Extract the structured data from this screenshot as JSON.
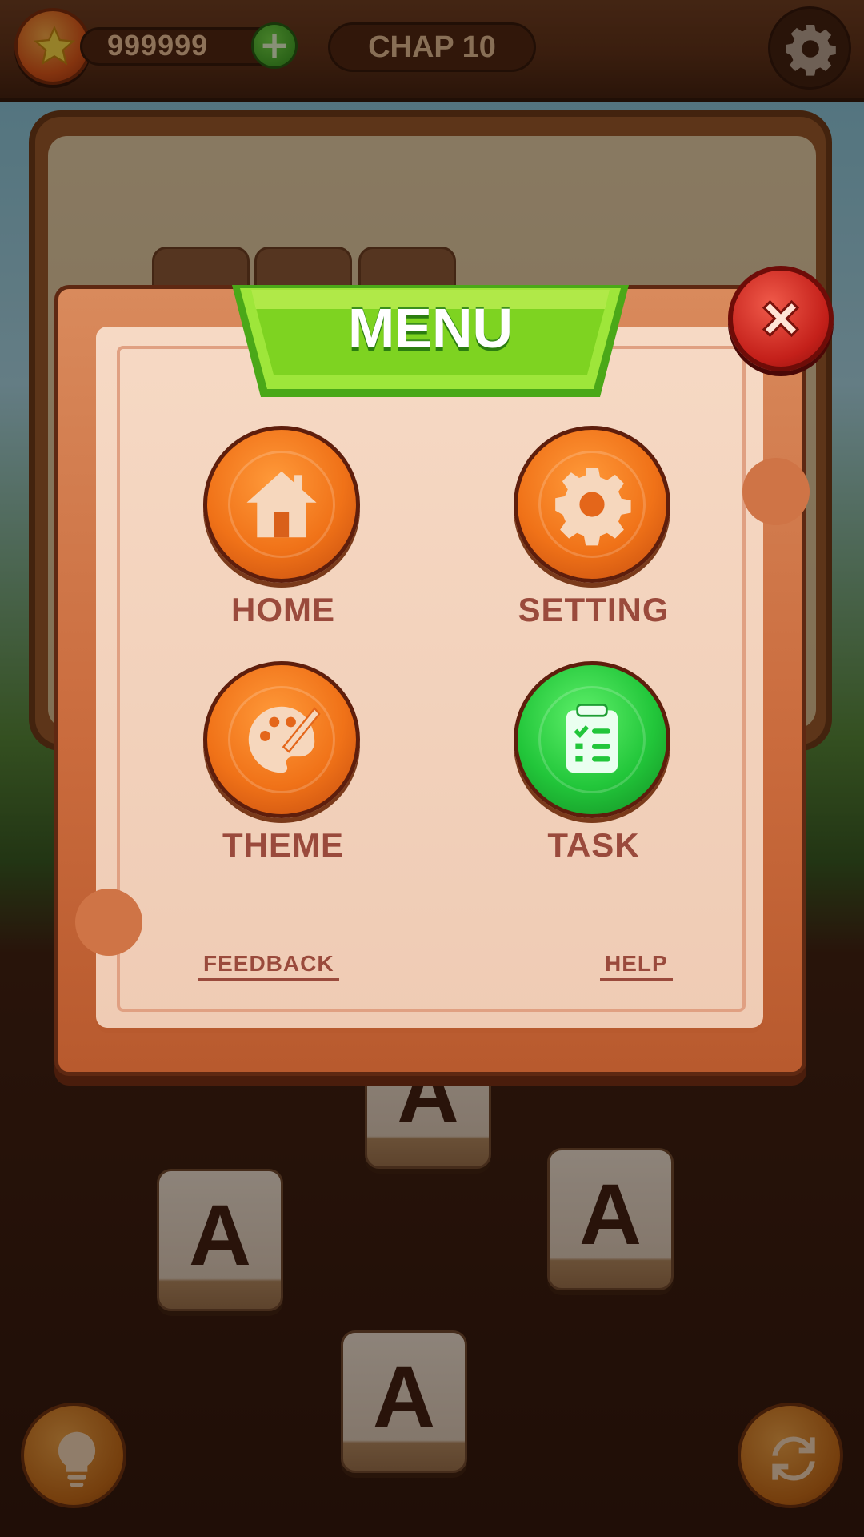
{
  "hud": {
    "coins": "999999",
    "add_coins_icon": "plus-icon",
    "chapter": "CHAP 10",
    "settings_icon": "gear-icon",
    "coin_icon": "star-icon"
  },
  "board": {
    "tiles": [
      "A",
      "A",
      "A",
      "A"
    ]
  },
  "menu": {
    "title": "MENU",
    "close_icon": "close-icon",
    "items": [
      {
        "label": "HOME",
        "icon": "home-icon",
        "color": "#f07218"
      },
      {
        "label": "SETTING",
        "icon": "gear-icon",
        "color": "#f07218"
      },
      {
        "label": "THEME",
        "icon": "palette-icon",
        "color": "#f07218"
      },
      {
        "label": "TASK",
        "icon": "task-list-icon",
        "color": "#22c63a"
      }
    ],
    "links": {
      "feedback": "FEEDBACK",
      "help": "HELP"
    }
  },
  "controls": {
    "hint_icon": "lightbulb-icon",
    "shuffle_icon": "shuffle-icon"
  },
  "colors": {
    "accent_green": "#7ed321",
    "close_red": "#c4201a",
    "label_brown": "#9a4a3c"
  }
}
